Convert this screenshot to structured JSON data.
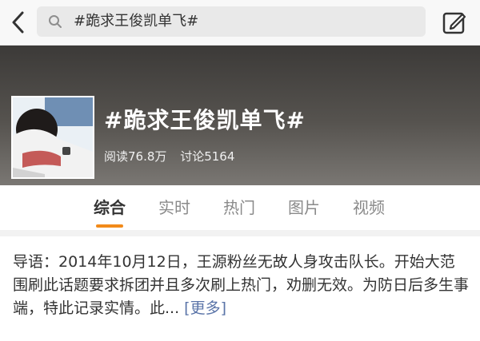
{
  "search": {
    "query": "#跪求王俊凯单飞#"
  },
  "icons": {
    "back": "chevron-left-icon",
    "search": "search-icon",
    "compose": "compose-icon"
  },
  "topic": {
    "title": "#跪求王俊凯单飞#",
    "reads_label": "阅读76.8万",
    "discussions_label": "讨论5164"
  },
  "tabs": [
    {
      "label": "综合",
      "active": true
    },
    {
      "label": "实时",
      "active": false
    },
    {
      "label": "热门",
      "active": false
    },
    {
      "label": "图片",
      "active": false
    },
    {
      "label": "视频",
      "active": false
    }
  ],
  "intro": {
    "text": "导语：2014年10月12日，王源粉丝无故人身攻击队长。开始大范围刷此话题要求拆团并且多次刷上热门，劝删无效。为防日后多生事端，特此记录实情。此...",
    "more_label": "[更多]"
  },
  "colors": {
    "accent": "#f28a1a",
    "link": "#5a74a8"
  }
}
